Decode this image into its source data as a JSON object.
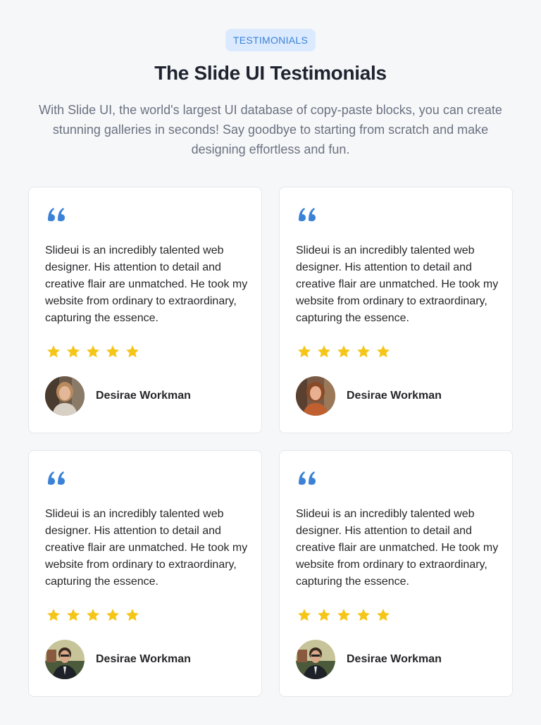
{
  "header": {
    "badge": "TESTIMONIALS",
    "title": "The Slide UI Testimonials",
    "subtitle": "With Slide UI, the world's largest UI database of copy-paste blocks, you can create stunning galleries in seconds! Say goodbye to starting from scratch and make designing effortless and fun."
  },
  "colors": {
    "accent": "#3b82d6",
    "star": "#f5c518",
    "background": "#f6f7f9"
  },
  "testimonials": [
    {
      "quote": "Slideui is an incredibly talented web designer. His attention to detail and creative flair are unmatched. He took my website from ordinary to extraordinary, capturing the essence.",
      "rating": 5,
      "author": "Desirae Workman"
    },
    {
      "quote": "Slideui is an incredibly talented web designer. His attention to detail and creative flair are unmatched. He took my website from ordinary to extraordinary, capturing the essence.",
      "rating": 5,
      "author": "Desirae Workman"
    },
    {
      "quote": "Slideui is an incredibly talented web designer. His attention to detail and creative flair are unmatched. He took my website from ordinary to extraordinary, capturing the essence.",
      "rating": 5,
      "author": "Desirae Workman"
    },
    {
      "quote": "Slideui is an incredibly talented web designer. His attention to detail and creative flair are unmatched. He took my website from ordinary to extraordinary, capturing the essence.",
      "rating": 5,
      "author": "Desirae Workman"
    }
  ]
}
